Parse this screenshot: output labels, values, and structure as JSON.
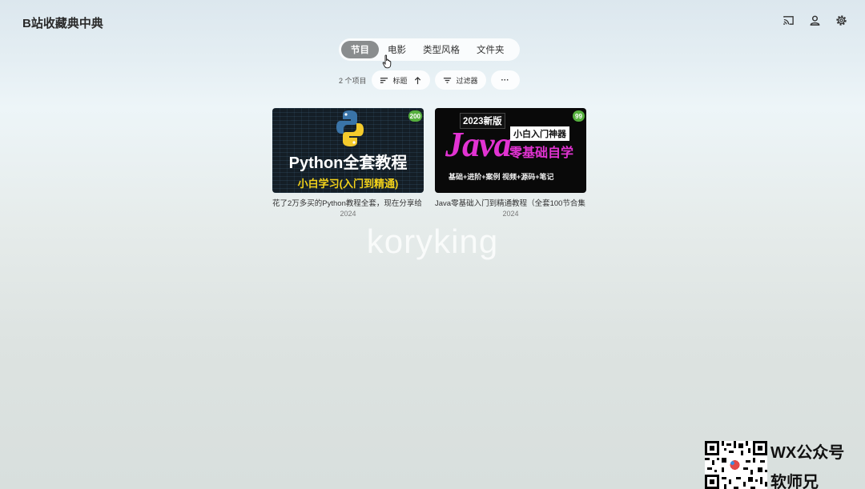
{
  "app_title": "B站收藏典中典",
  "header_icons": [
    "cast-icon",
    "user-icon",
    "settings-gear-icon"
  ],
  "tabs": [
    {
      "label": "节目",
      "active": true
    },
    {
      "label": "电影",
      "active": false
    },
    {
      "label": "类型风格",
      "active": false
    },
    {
      "label": "文件夹",
      "active": false
    }
  ],
  "toolbar": {
    "count": "2 个项目",
    "sort_label": "标题",
    "filter_label": "过滤器",
    "more_label": "···"
  },
  "items": [
    {
      "title": "花了2万多买的Python教程全套，现在分享给",
      "year": "2024",
      "badge": "200",
      "thumb_main": "Python全套教程",
      "thumb_sub": "小白学习(入门到精通)"
    },
    {
      "title": "Java零基础入门到精通教程（全套100节合集",
      "year": "2024",
      "badge": "99",
      "thumb_year": "2023新版",
      "thumb_java": "Java",
      "thumb_box": "小白入门神器",
      "thumb_big": "零基础自学",
      "thumb_sub": "基础+进阶+案例 视频+源码+笔记"
    }
  ],
  "watermark": "koryking",
  "wx": {
    "line1": "WX公众号",
    "line2": "软师兄"
  },
  "colors": {
    "active_tab": "#8a8d8e",
    "badge": "#56b03e",
    "java_accent": "#e233d2",
    "python_accent": "#f3d21a"
  }
}
